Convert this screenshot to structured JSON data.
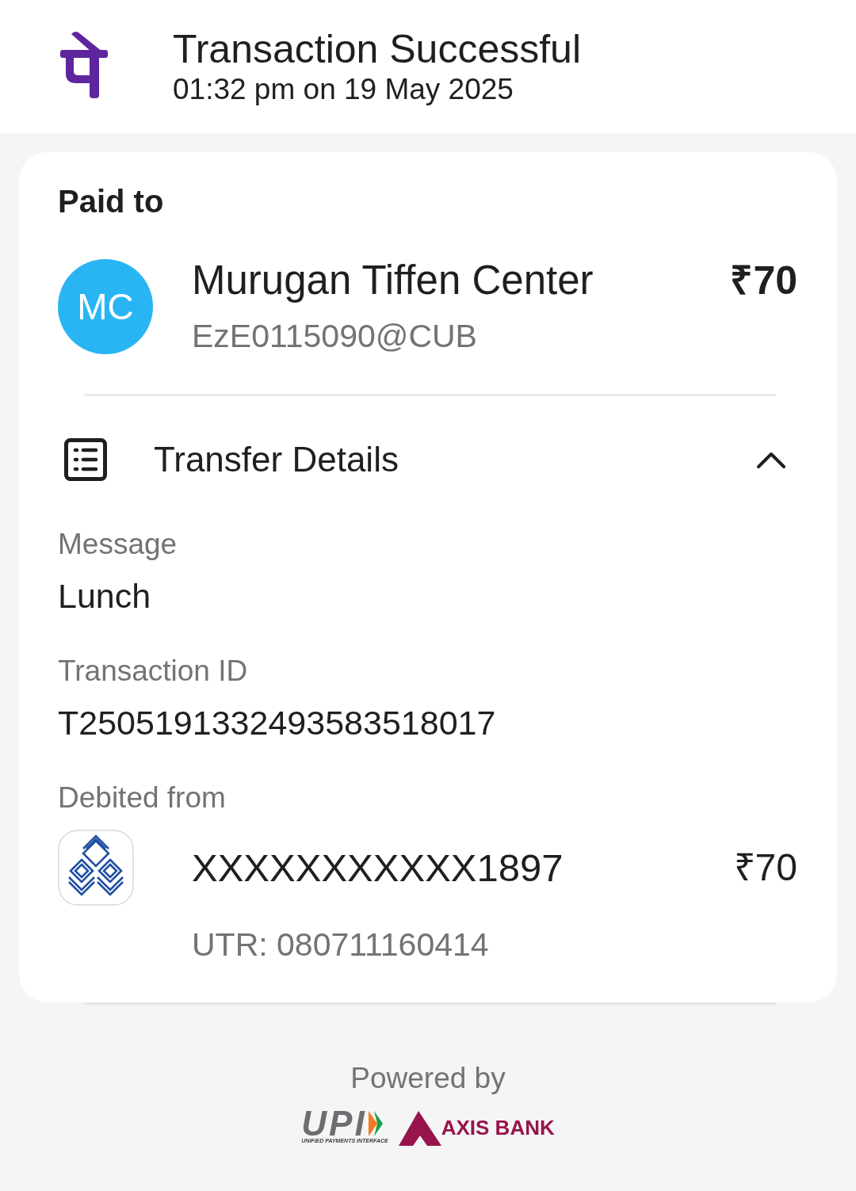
{
  "header": {
    "title": "Transaction Successful",
    "subtitle": "01:32 pm on 19 May 2025"
  },
  "paid_to": {
    "heading": "Paid to",
    "avatar": "MC",
    "name": "Murugan Tiffen Center",
    "vpa": "EzE0115090@CUB",
    "amount": "₹70"
  },
  "transfer_details": {
    "title": "Transfer Details",
    "expanded": true,
    "fields": [
      {
        "label": "Message",
        "value": "Lunch"
      },
      {
        "label": "Transaction ID",
        "value": "T2505191332493583518017"
      }
    ],
    "debited_from": {
      "label": "Debited from",
      "account": "XXXXXXXXXXX1897",
      "amount": "₹70",
      "utr": "UTR: 080711160414"
    }
  },
  "footer": {
    "powered_by": "Powered by",
    "upi_wordmark": "UPI",
    "upi_tagline": "UNIFIED PAYMENTS INTERFACE",
    "bank_wordmark": "AXIS BANK"
  }
}
